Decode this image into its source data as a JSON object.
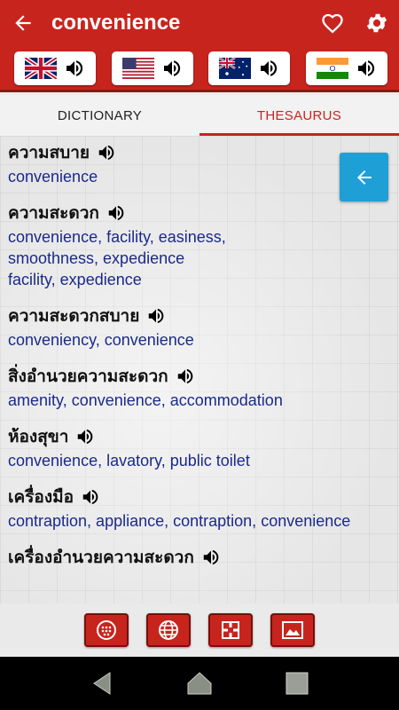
{
  "header": {
    "title": "convenience",
    "back_icon": "arrow-left-icon",
    "favorite_icon": "heart-icon",
    "settings_icon": "gear-icon"
  },
  "flags": [
    {
      "country": "uk",
      "icon": "uk-flag-icon"
    },
    {
      "country": "us",
      "icon": "us-flag-icon"
    },
    {
      "country": "australia",
      "icon": "australia-flag-icon"
    },
    {
      "country": "india",
      "icon": "india-flag-icon"
    }
  ],
  "tabs": [
    {
      "label": "DICTIONARY"
    },
    {
      "label": "THESAURUS"
    }
  ],
  "active_tab": "THESAURUS",
  "entries": [
    {
      "word": "ความสบาย",
      "lines": [
        "convenience"
      ]
    },
    {
      "word": "ความสะดวก",
      "lines": [
        "convenience, facility, easiness,",
        "smoothness, expedience",
        "facility, expedience"
      ]
    },
    {
      "word": "ความสะดวกสบาย",
      "lines": [
        "conveniency, convenience"
      ]
    },
    {
      "word": "สิ่งอำนวยความสะดวก",
      "lines": [
        "amenity, convenience, accommodation"
      ]
    },
    {
      "word": "ห้องสุขา",
      "lines": [
        "convenience, lavatory, public toilet"
      ]
    },
    {
      "word": "เครื่องมือ",
      "lines": [
        "contraption, appliance, contraption, convenience"
      ]
    },
    {
      "word": "เครื่องอำนวยความสะดวก",
      "lines": []
    }
  ],
  "toolbar": {
    "icons": [
      "dots-circle-icon",
      "globe-icon",
      "crosshair-icon",
      "image-icon"
    ]
  },
  "colors": {
    "primary": "#c8241e",
    "accent": "#1e9fd6",
    "definition_text": "#1a2a8a"
  }
}
